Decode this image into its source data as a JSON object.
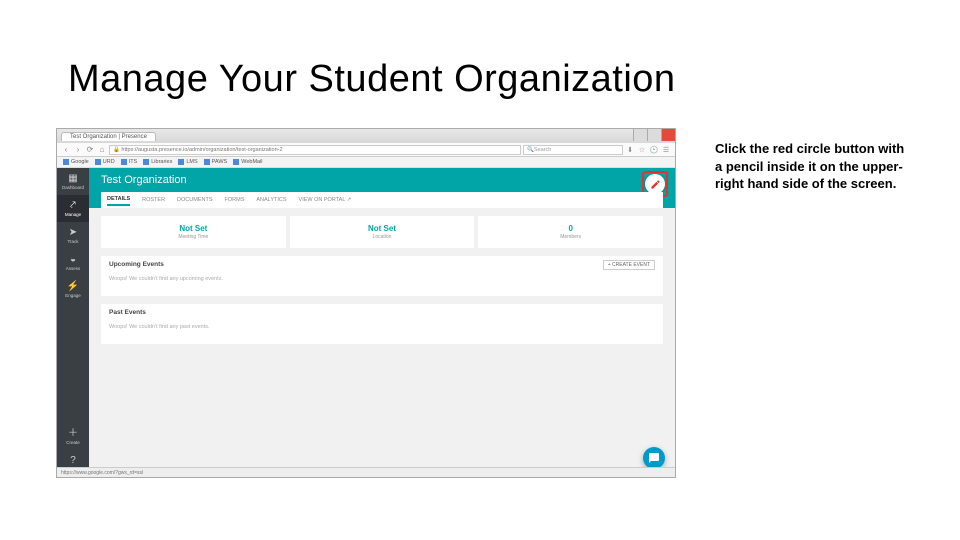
{
  "slide": {
    "title": "Manage Your Student Organization",
    "instruction": "Click the red circle button with a pencil inside it on the upper-right hand side of the screen."
  },
  "browser": {
    "tab_title": "Test Organization | Presence",
    "url": "https://augusta.presence.io/admin/organization/test-organization-2",
    "search_placeholder": "Search",
    "bookmarks": [
      "Google",
      "URD",
      "ITS",
      "Libraries",
      "LMS",
      "PAWS",
      "WebMail"
    ],
    "status_text": "https://www.google.com/?gws_rd=ssl"
  },
  "sidebar": {
    "items": [
      {
        "label": "Dashboard"
      },
      {
        "label": "Manage"
      },
      {
        "label": "Track"
      },
      {
        "label": "Assess"
      },
      {
        "label": "Engage"
      }
    ],
    "bottom": [
      {
        "label": "Create"
      },
      {
        "label": "Support"
      }
    ]
  },
  "page": {
    "org_title": "Test Organization",
    "tabs": [
      "DETAILS",
      "ROSTER",
      "DOCUMENTS",
      "FORMS",
      "ANALYTICS",
      "VIEW ON PORTAL ↗"
    ],
    "stats": [
      {
        "value": "Not Set",
        "label": "Meeting Time"
      },
      {
        "value": "Not Set",
        "label": "Location"
      },
      {
        "value": "0",
        "label": "Members"
      }
    ],
    "upcoming": {
      "title": "Upcoming Events",
      "msg": "Woops! We couldn't find any upcoming events.",
      "create_label": "+ CREATE EVENT"
    },
    "past": {
      "title": "Past Events",
      "msg": "Woops! We couldn't find any past events."
    }
  }
}
